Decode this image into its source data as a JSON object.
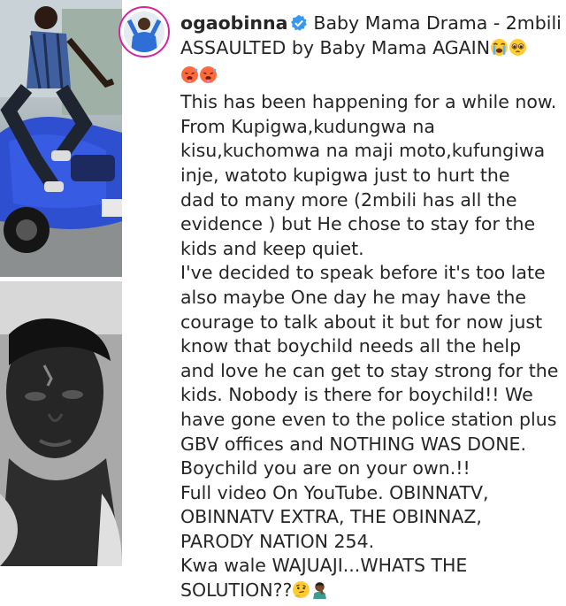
{
  "post": {
    "username": "ogaobinna",
    "verified": true,
    "headline": "Baby Mama Drama - 2mbili",
    "caption_lines": [
      "ASSAULTED by Baby Mama AGAIN",
      "",
      "This has been happening for a while now.",
      "From Kupigwa,kudungwa na",
      "kisu,kuchomwa na maji moto,kufungiwa",
      "inje, watoto kupigwa just to hurt the",
      "dad to many more (2mbili has all the",
      "evidence )  but He chose to stay for the",
      "kids and keep quiet.",
      "I've decided to speak before it's too late",
      "also maybe One day he may have the",
      "courage to talk about it but for now just",
      "know that boychild needs all the help",
      "and love he can get to stay strong for the",
      "kids. Nobody is there for boychild!! We",
      "have gone even to the police station plus",
      "GBV offices and NOTHING WAS DONE.",
      "Boychild you are on your own.!!",
      " Full video On YouTube. OBINNATV,",
      "OBINNATV EXTRA, THE OBINNAZ,",
      "PARODY NATION 254.",
      "Kwa wale WAJUAJI...WHATS THE",
      "SOLUTION??"
    ],
    "emojis": {
      "line1": [
        "loudly-crying-face",
        "pleading-face"
      ],
      "line2": [
        "hot-face",
        "hot-face"
      ],
      "last": [
        "thinking-face",
        "man-facepalming"
      ]
    }
  },
  "colors": {
    "text": "#262626",
    "verified_badge": "#3897f0",
    "story_ring": "#d6249f"
  }
}
